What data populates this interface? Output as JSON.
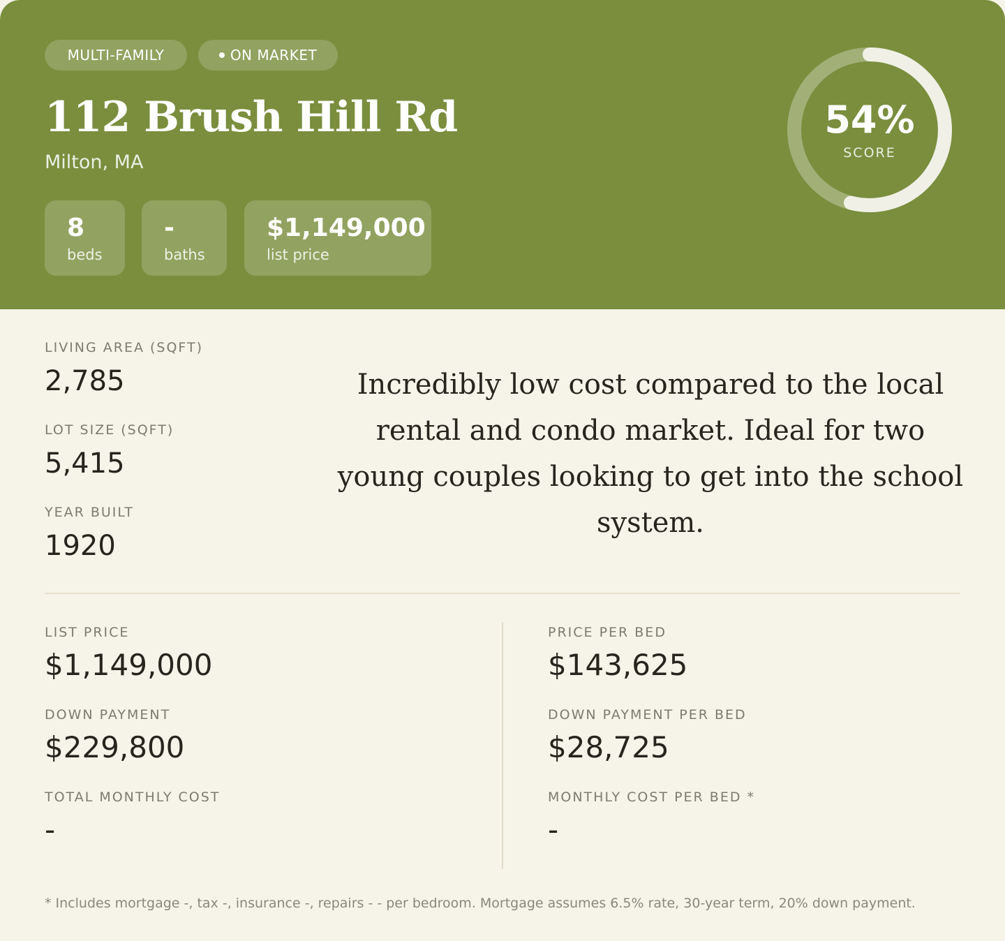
{
  "header": {
    "type_badge": "MULTI-FAMILY",
    "status_badge": "ON MARKET",
    "address": "112 Brush Hill Rd",
    "city": "Milton, MA",
    "stats": [
      {
        "value": "8",
        "label": "beds"
      },
      {
        "value": "-",
        "label": "baths"
      },
      {
        "value": "$1,149,000",
        "label": "list price"
      }
    ],
    "score": {
      "value_text": "54%",
      "label": "SCORE",
      "fraction": 0.54
    }
  },
  "facts": [
    {
      "label": "LIVING AREA (SQFT)",
      "value": "2,785"
    },
    {
      "label": "LOT SIZE (SQFT)",
      "value": "5,415"
    },
    {
      "label": "YEAR BUILT",
      "value": "1920"
    }
  ],
  "description": "Incredibly low cost compared to the local rental and condo market. Ideal for two young couples looking to get into the school system.",
  "financials": {
    "left": [
      {
        "label": "LIST PRICE",
        "value": "$1,149,000"
      },
      {
        "label": "DOWN PAYMENT",
        "value": "$229,800"
      },
      {
        "label": "TOTAL MONTHLY COST",
        "value": "-"
      }
    ],
    "right": [
      {
        "label": "PRICE PER BED",
        "value": "$143,625"
      },
      {
        "label": "DOWN PAYMENT PER BED",
        "value": "$28,725"
      },
      {
        "label": "MONTHLY COST PER BED *",
        "value": "-"
      }
    ]
  },
  "footnote": "* Includes mortgage -, tax -, insurance -, repairs - - per bedroom. Mortgage assumes 6.5% rate, 30-year term, 20% down payment.",
  "colors": {
    "header_bg": "#7a8e3e",
    "page_bg": "#f6f4e9",
    "text_dark": "#26251e",
    "label_gray": "#7d7b70"
  }
}
